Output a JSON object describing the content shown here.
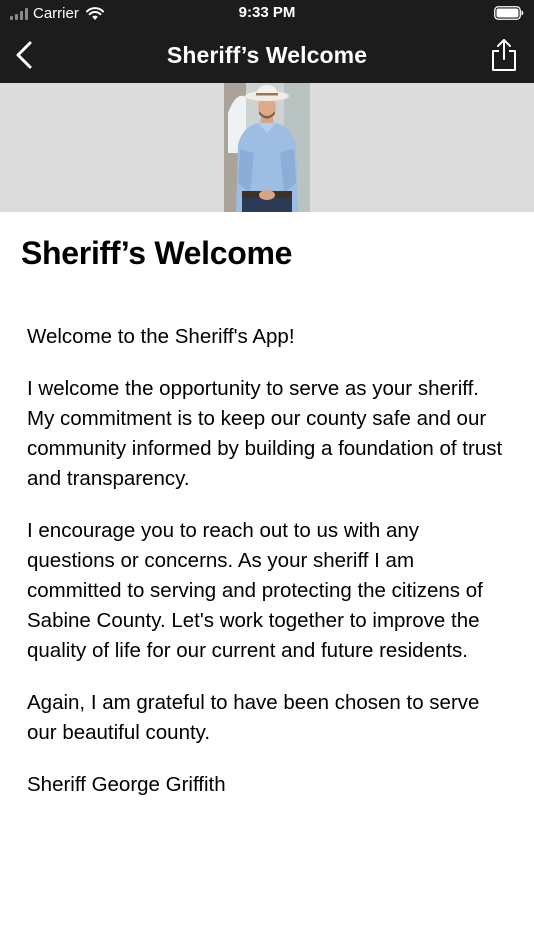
{
  "status_bar": {
    "carrier": "Carrier",
    "time": "9:33 PM"
  },
  "nav": {
    "title": "Sheriff’s Welcome",
    "back_icon": "chevron-left-icon",
    "share_icon": "share-icon"
  },
  "hero": {
    "image": "sheriff-portrait"
  },
  "content": {
    "title": "Sheriff’s Welcome",
    "paragraphs": [
      "Welcome to the Sheriff's App!",
      "I welcome the opportunity to serve as your sheriff. My commitment is to keep our county safe and our community informed by building a foundation of trust and transparency.",
      "I encourage you to reach out to us with any questions or concerns.  As your sheriff I am committed to serving and protecting the citizens of Sabine County.  Let's work together to improve the quality of life for our current and future residents.",
      "Again, I am grateful to have been chosen to serve our beautiful county.",
      "Sheriff George Griffith"
    ]
  },
  "colors": {
    "bar_background": "#1c1c1c",
    "hero_background": "#dcdcdc"
  }
}
